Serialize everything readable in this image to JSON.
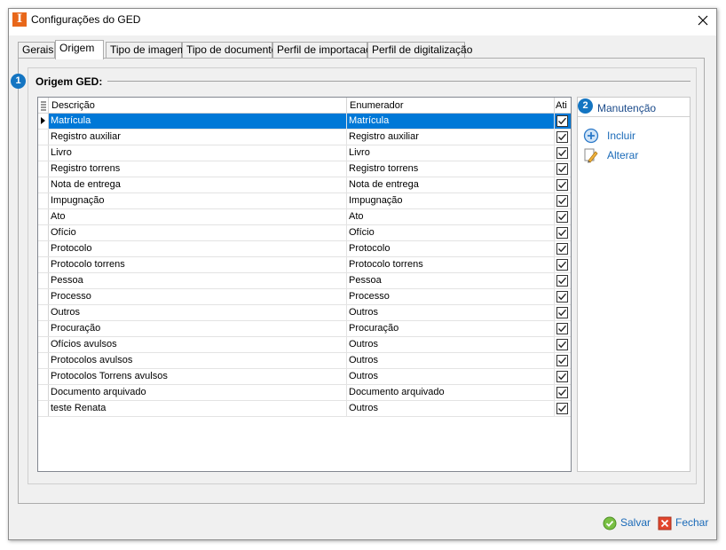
{
  "window": {
    "title": "Configurações do GED",
    "app_icon_letter": "I"
  },
  "tabs": [
    {
      "label": "Gerais",
      "active": false
    },
    {
      "label": "Origem",
      "active": true
    },
    {
      "label": "Tipo de imagem",
      "active": false
    },
    {
      "label": "Tipo de documento",
      "active": false
    },
    {
      "label": "Perfil de importacao",
      "active": false
    },
    {
      "label": "Perfil de digitalização",
      "active": false
    }
  ],
  "section": {
    "badge": "1",
    "title": "Origem GED:"
  },
  "grid": {
    "columns": {
      "descricao": "Descrição",
      "enumerador": "Enumerador",
      "ativo": "Ati"
    },
    "selected_row": 0,
    "rows": [
      {
        "descricao": "Matrícula",
        "enumerador": "Matrícula",
        "ativo": true
      },
      {
        "descricao": "Registro auxiliar",
        "enumerador": "Registro auxiliar",
        "ativo": true
      },
      {
        "descricao": "Livro",
        "enumerador": "Livro",
        "ativo": true
      },
      {
        "descricao": "Registro torrens",
        "enumerador": "Registro torrens",
        "ativo": true
      },
      {
        "descricao": "Nota de entrega",
        "enumerador": "Nota de entrega",
        "ativo": true
      },
      {
        "descricao": "Impugnação",
        "enumerador": "Impugnação",
        "ativo": true
      },
      {
        "descricao": "Ato",
        "enumerador": "Ato",
        "ativo": true
      },
      {
        "descricao": "Ofício",
        "enumerador": "Ofício",
        "ativo": true
      },
      {
        "descricao": "Protocolo",
        "enumerador": "Protocolo",
        "ativo": true
      },
      {
        "descricao": "Protocolo torrens",
        "enumerador": "Protocolo torrens",
        "ativo": true
      },
      {
        "descricao": "Pessoa",
        "enumerador": "Pessoa",
        "ativo": true
      },
      {
        "descricao": "Processo",
        "enumerador": "Processo",
        "ativo": true
      },
      {
        "descricao": "Outros",
        "enumerador": "Outros",
        "ativo": true
      },
      {
        "descricao": "Procuração",
        "enumerador": "Procuração",
        "ativo": true
      },
      {
        "descricao": "Ofícios avulsos",
        "enumerador": "Outros",
        "ativo": true
      },
      {
        "descricao": "Protocolos avulsos",
        "enumerador": "Outros",
        "ativo": true
      },
      {
        "descricao": "Protocolos Torrens avulsos",
        "enumerador": "Outros",
        "ativo": true
      },
      {
        "descricao": "Documento arquivado",
        "enumerador": "Documento arquivado",
        "ativo": true
      },
      {
        "descricao": "teste Renata",
        "enumerador": "Outros",
        "ativo": true
      }
    ]
  },
  "maintenance": {
    "badge": "2",
    "title": "Manutenção",
    "actions": [
      {
        "label": "Incluir",
        "icon": "add-circle-icon"
      },
      {
        "label": "Alterar",
        "icon": "edit-pencil-icon"
      }
    ]
  },
  "footer": {
    "save_label": "Salvar",
    "close_label": "Fechar"
  },
  "colors": {
    "selection": "#0078d7",
    "badge": "#1475c2",
    "link": "#1a6ab8",
    "app_icon": "#e8671a"
  }
}
